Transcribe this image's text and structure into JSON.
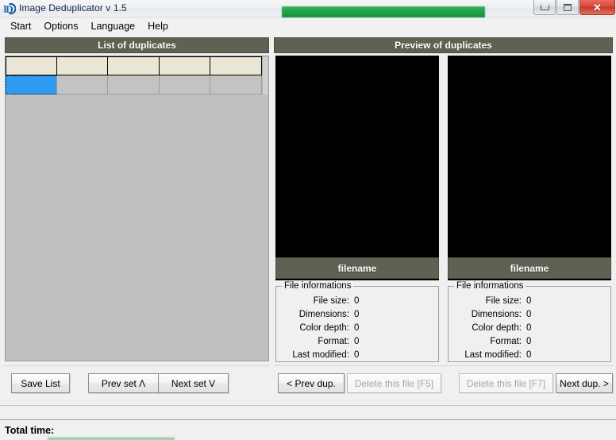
{
  "window": {
    "title": "Image Deduplicator v 1.5",
    "icon": "app-id-icon",
    "minimize_label": "",
    "maximize_label": "",
    "close_label": "✕",
    "title_progress_color": "#26a24a"
  },
  "menubar": {
    "items": [
      {
        "label": "Start"
      },
      {
        "label": "Options"
      },
      {
        "label": "Language"
      },
      {
        "label": "Help"
      }
    ]
  },
  "left_panel": {
    "header": "List of duplicates",
    "grid": {
      "header_cells": [
        "",
        "",
        "",
        "",
        ""
      ],
      "rows": [
        {
          "cells": [
            "",
            "",
            "",
            "",
            ""
          ],
          "selected_index": 0
        }
      ],
      "selected_cell_color": "#2f9cf4",
      "header_cell_color": "#eae6d5",
      "row_cell_color": "#c3c3c3"
    },
    "buttons": [
      {
        "label": "Save List",
        "enabled": true
      },
      {
        "label": "Prev set Λ",
        "enabled": true
      },
      {
        "label": "Next set V",
        "enabled": true
      }
    ]
  },
  "right_panel": {
    "header": "Preview of duplicates",
    "previews": [
      {
        "filename": "filename",
        "image": ""
      },
      {
        "filename": "filename",
        "image": ""
      }
    ],
    "file_info": [
      {
        "title": "File informations",
        "fields": [
          {
            "label": "File size:",
            "value": "0"
          },
          {
            "label": "Dimensions:",
            "value": "0"
          },
          {
            "label": "Color depth:",
            "value": "0"
          },
          {
            "label": "Format:",
            "value": "0"
          },
          {
            "label": "Last modified:",
            "value": "0"
          }
        ]
      },
      {
        "title": "File informations",
        "fields": [
          {
            "label": "File size:",
            "value": "0"
          },
          {
            "label": "Dimensions:",
            "value": "0"
          },
          {
            "label": "Color depth:",
            "value": "0"
          },
          {
            "label": "Format:",
            "value": "0"
          },
          {
            "label": "Last modified:",
            "value": "0"
          }
        ]
      }
    ],
    "buttons": [
      {
        "label": "< Prev dup.",
        "enabled": true
      },
      {
        "label": "Delete this file [F5]",
        "enabled": false
      },
      {
        "label": "Delete this file [F7]",
        "enabled": false
      },
      {
        "label": "Next dup. >",
        "enabled": true
      }
    ]
  },
  "statusbar": {
    "total_time_label": "Total time:"
  },
  "colors": {
    "panel_header": "#5f6152",
    "accent_selection": "#2f9cf4",
    "grid_header": "#eae6d5",
    "window_background": "#f0f0f0",
    "progress_green": "#26a24a"
  }
}
